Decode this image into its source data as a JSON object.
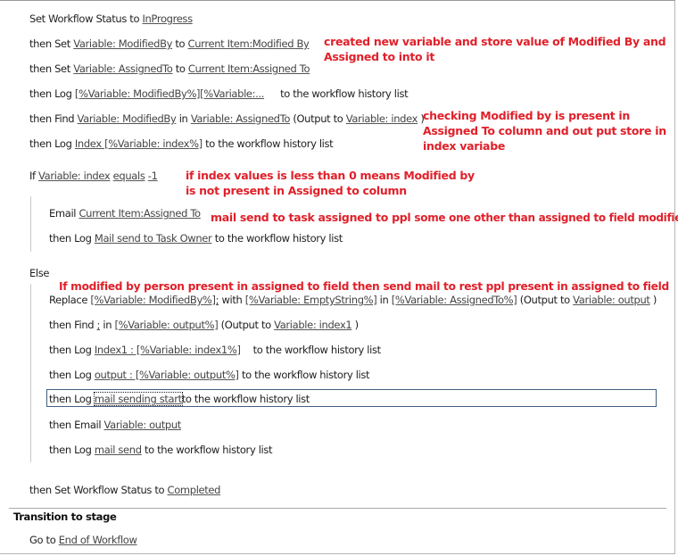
{
  "steps": {
    "s1": {
      "prefix": "Set Workflow Status to ",
      "value": "InProgress"
    },
    "s2": {
      "prefix": "then Set ",
      "var": "Variable: ModifiedBy",
      "mid": " to ",
      "value": "Current Item:Modified By"
    },
    "s3": {
      "prefix": "then Set ",
      "var": "Variable: AssignedTo",
      "mid": " to ",
      "value": "Current Item:Assigned To"
    },
    "s4": {
      "prefix": "then Log ",
      "value": "[%Variable: ModifiedBy%][%Variable:...",
      "suffix": "to the workflow history list"
    },
    "s5": {
      "prefix": "then Find ",
      "var": "Variable: ModifiedBy",
      "mid": " in ",
      "in": "Variable: AssignedTo",
      "mid2": " (Output to ",
      "out": "Variable: index",
      "suffix": " )"
    },
    "s6": {
      "prefix": "then Log ",
      "value": "Index [%Variable: index%]",
      "suffix": " to the workflow history list"
    }
  },
  "condition": {
    "if_label": "If ",
    "var": "Variable: index",
    "op": "equals",
    "value": "-1",
    "else_label": "Else"
  },
  "if_branch": {
    "b1": {
      "prefix": "Email ",
      "value": "Current Item:Assigned To"
    },
    "b2": {
      "prefix": "then Log ",
      "value": "Mail send to Task Owner",
      "suffix": " to the workflow history list"
    }
  },
  "else_branch": {
    "e1": {
      "prefix": "Replace ",
      "find": "[%Variable: ModifiedBy%];",
      "mid": " with ",
      "with": "[%Variable: EmptyString%]",
      "mid2": " in ",
      "in": "[%Variable: AssignedTo%]",
      "mid3": " (Output to ",
      "out": "Variable: output",
      "suffix": " )"
    },
    "e2": {
      "prefix": "then Find ",
      "find": ";",
      "mid": " in ",
      "in": "[%Variable: output%]",
      "mid2": " (Output to ",
      "out": "Variable: index1",
      "suffix": " )"
    },
    "e3": {
      "prefix": "then Log ",
      "value": "Index1 : [%Variable: index1%]",
      "suffix": "to the workflow history list"
    },
    "e4": {
      "prefix": "then Log ",
      "value": "output : [%Variable: output%]",
      "suffix": " to the workflow history list"
    },
    "e5": {
      "prefix": "then Log ",
      "value": "mail sending start",
      "suffix": "to the workflow history list"
    },
    "e6": {
      "prefix": "then Email ",
      "value": "Variable: output"
    },
    "e7": {
      "prefix": "then Log ",
      "value": "mail send",
      "suffix": " to the workflow history list"
    }
  },
  "final_step": {
    "prefix": "then Set Workflow Status to ",
    "value": "Completed "
  },
  "transition": {
    "title": "Transition to stage",
    "prefix": "Go to ",
    "value": "End of Workflow"
  },
  "annotations": {
    "a1_line1": "created new variable and store value of Modified By and",
    "a1_line2": "Assigned to into it",
    "a2_line1": "checking Modified by is present in",
    "a2_line2": "Assigned To column and out put store in",
    "a2_line3": "index variabe",
    "a3_line1": "if index values is less than 0 means Modified by",
    "a3_line2": "is not present in Assigned to column",
    "a4_part1": "mail send to task assigned to ppl",
    "a4_part2": "some one other than assigned to field modified list",
    "a5": "If modified by person present in assigned to field then send mail to rest ppl present in assigned to field"
  },
  "colors": {
    "annotation": "#e0202a",
    "selection_border": "#41607e",
    "link": "#444444"
  }
}
